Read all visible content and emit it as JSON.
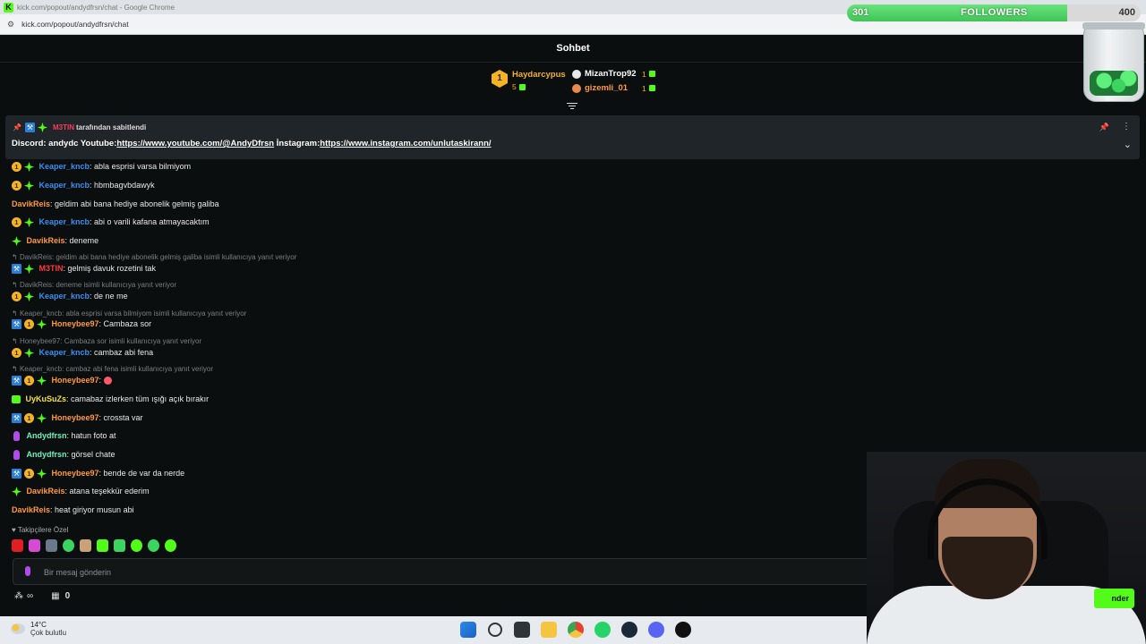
{
  "browser": {
    "window_title": "kick.com/popout/andydfrsn/chat - Google Chrome",
    "url": "kick.com/popout/andydfrsn/chat"
  },
  "followers_goal": {
    "current": "301",
    "label": "FOLLOWERS",
    "goal": "400",
    "progress_fraction": 0.75
  },
  "chat": {
    "title": "Sohbet",
    "leaderboard": {
      "top": {
        "rank": "1",
        "name": "Haydarcypus",
        "count": "5"
      },
      "others": [
        {
          "name": "MizanTrop92",
          "count": "1"
        },
        {
          "name": "gizemli_01",
          "count": "1"
        }
      ]
    },
    "pinned": {
      "pinned_by": "M3TIN",
      "pinned_suffix": "tarafından sabitlendi",
      "text_prefix": "Discord: andydc Youtube:",
      "youtube_link": "https://www.youtube.com/@AndyDfrsn",
      "instagram_label": " İnstagram:",
      "instagram_link": "https://www.instagram.com/unlutaskirann/"
    },
    "messages": [
      {
        "user": "Keaper_kncb",
        "text": ": abla esprisi varsa bilmiyom"
      },
      {
        "user": "Keaper_kncb",
        "text": ": hbmbagvbdawyk"
      },
      {
        "user": "DavikReis",
        "text": ": geldim abi bana hediye abonelik gelmiş galiba"
      },
      {
        "user": "Keaper_kncb",
        "text": ": abi o varili kafana atmayacaktım"
      },
      {
        "user": "DavikReis",
        "text": ": deneme"
      },
      {
        "reply": "DavikReis: geldim abi bana hediye abonelik gelmiş galiba isimli kullanıcıya yanıt veriyor",
        "user": "M3TIN",
        "text": ": gelmiş davuk rozetini tak"
      },
      {
        "reply": "DavikReis: deneme isimli kullanıcıya yanıt veriyor",
        "user": "Keaper_kncb",
        "text": ": de ne me"
      },
      {
        "reply": "Keaper_kncb: abla esprisi varsa bilmiyom isimli kullanıcıya yanıt veriyor",
        "user": "Honeybee97",
        "text": ": Cambaza sor"
      },
      {
        "reply": "Honeybee97: Cambaza sor isimli kullanıcıya yanıt veriyor",
        "user": "Keaper_kncb",
        "text": ": cambaz abi fena"
      },
      {
        "reply": "Keaper_kncb: cambaz abi fena isimli kullanıcıya yanıt veriyor",
        "user": "Honeybee97",
        "text": ": "
      },
      {
        "user": "UyKuSuZs",
        "text": ": camabaz izlerken tüm ışığı açık bırakır"
      },
      {
        "user": "Honeybee97",
        "text": ": crossta var"
      },
      {
        "user": "Andydfrsn",
        "text": ": hatun foto at"
      },
      {
        "user": "Andydfrsn",
        "text": ": görsel chate"
      },
      {
        "user": "Honeybee97",
        "text": ": bende de var da nerde"
      },
      {
        "user": "DavikReis",
        "text": ": atana teşekkür ederim"
      },
      {
        "user": "DavikReis",
        "text": ": heat giriyor musun abi"
      }
    ],
    "followers_only_label": "Takipçilere Özel",
    "input_placeholder": "Bir mesaj gönderin",
    "bottom_count": "0",
    "send_label": "nder"
  },
  "taskbar": {
    "temperature": "14°C",
    "weather": "Çok bulutlu"
  }
}
